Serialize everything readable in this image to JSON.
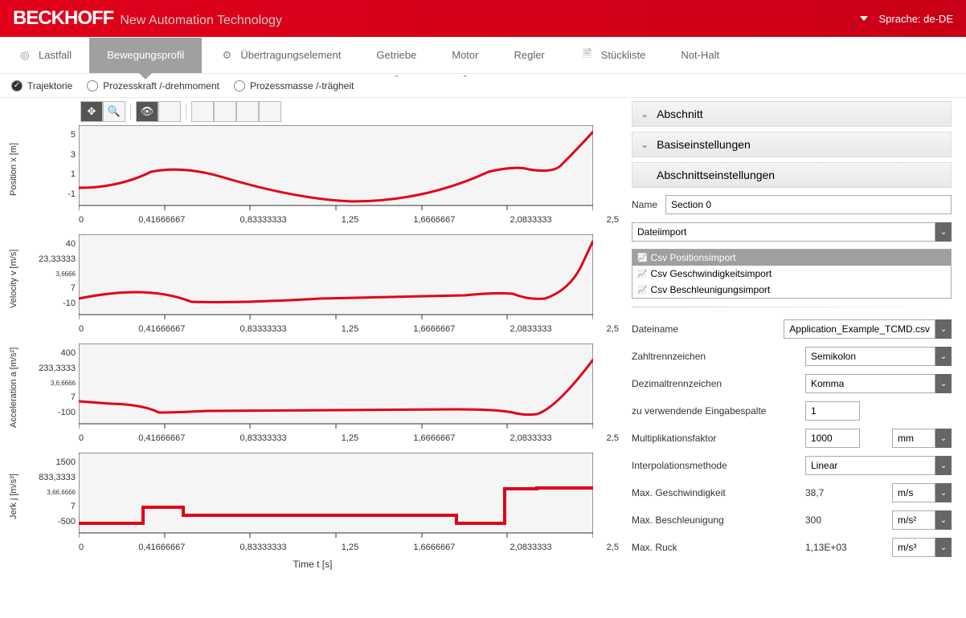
{
  "header": {
    "brand": "BECKHOFF",
    "brandSub": "New Automation Technology",
    "lang": "Sprache: de-DE"
  },
  "tabs": {
    "lastfall": "Lastfall",
    "bewegungsprofil": "Bewegungsprofil",
    "uebertragung": "Übertragungselement",
    "getriebe": "Getriebe",
    "motor": "Motor",
    "regler": "Regler",
    "stueckliste": "Stückliste",
    "nothalt": "Not-Halt"
  },
  "subtabs": {
    "trajektorie": "Trajektorie",
    "prozesskraft": "Prozesskraft /-drehmoment",
    "prozessmasse": "Prozessmasse /-trägheit"
  },
  "charts": {
    "ylabels": {
      "pos": "Position x [m]",
      "vel": "Velocity v [m/s]",
      "acc": "Acceleration a [m/s²]",
      "jerk": "Jerk j [m/s³]"
    },
    "yticks": {
      "pos": [
        "5",
        "3",
        "1",
        "-1"
      ],
      "vel": [
        "40",
        "23,33333",
        "3,6666",
        "7",
        "-10"
      ],
      "acc": [
        "400",
        "233,3333",
        "3,6,6666",
        "7",
        "-100"
      ],
      "jerk": [
        "1500",
        "833,3333",
        "3,66,6666",
        "7",
        "-500"
      ]
    },
    "xticks": [
      "0",
      "0,41666667",
      "0,83333333",
      "1,25",
      "1,6666667",
      "2,0833333",
      "2,5"
    ],
    "xlabel": "Time t [s]"
  },
  "side": {
    "abschnitt": "Abschnitt",
    "basis": "Basiseinstellungen",
    "abschnittSettings": "Abschnittseinstellungen",
    "nameLabel": "Name",
    "nameVal": "Section 0",
    "importType": "Dateiimport",
    "importOptions": {
      "pos": "Csv Positionsimport",
      "vel": "Csv Geschwindigkeitsimport",
      "acc": "Csv Beschleunigungsimport"
    },
    "dateinameLabel": "Dateiname",
    "dateinameVal": "Application_Example_TCMD.csv",
    "zahlLabel": "Zahltrennzeichen",
    "zahlVal": "Semikolon",
    "dezLabel": "Dezimaltrennzeichen",
    "dezVal": "Komma",
    "spalteLabel": "zu verwendende Eingabespalte",
    "spalteVal": "1",
    "multLabel": "Multiplikationsfaktor",
    "multVal": "1000",
    "multUnit": "mm",
    "interpLabel": "Interpolationsmethode",
    "interpVal": "Linear",
    "maxVLabel": "Max. Geschwindigkeit",
    "maxVVal": "38,7",
    "maxVUnit": "m/s",
    "maxALabel": "Max. Beschleunigung",
    "maxAVal": "300",
    "maxAUnit": "m/s²",
    "maxRLabel": "Max. Ruck",
    "maxRVal": "1,13E+03",
    "maxRUnit": "m/s³"
  },
  "chart_data": [
    {
      "type": "line",
      "name": "Position x",
      "x": [
        0,
        0.417,
        0.833,
        1.25,
        1.667,
        2.083,
        2.5
      ],
      "y": [
        0.3,
        0.8,
        -0.1,
        -0.5,
        -0.2,
        0.8,
        4.2
      ],
      "xlabel": "Time t [s]",
      "ylabel": "Position x [m]",
      "ylim": [
        -1,
        5
      ]
    },
    {
      "type": "line",
      "name": "Velocity v",
      "x": [
        0,
        0.417,
        0.833,
        1.25,
        1.667,
        2.083,
        2.5
      ],
      "y": [
        1,
        4,
        0,
        1,
        2,
        3,
        38
      ],
      "xlabel": "Time t [s]",
      "ylabel": "Velocity v [m/s]",
      "ylim": [
        -10,
        40
      ]
    },
    {
      "type": "line",
      "name": "Acceleration a",
      "x": [
        0,
        0.417,
        0.833,
        1.25,
        1.667,
        2.083,
        2.5
      ],
      "y": [
        20,
        -20,
        -20,
        -20,
        -20,
        -40,
        280
      ],
      "xlabel": "Time t [s]",
      "ylabel": "Acceleration a [m/s²]",
      "ylim": [
        -100,
        400
      ]
    },
    {
      "type": "line",
      "name": "Jerk j",
      "x": [
        0,
        0.3,
        0.3,
        0.5,
        0.5,
        1.8,
        1.8,
        2.0,
        2.0,
        2.5
      ],
      "y": [
        -300,
        -300,
        100,
        100,
        -100,
        -100,
        -300,
        -300,
        600,
        600
      ],
      "xlabel": "Time t [s]",
      "ylabel": "Jerk j [m/s³]",
      "ylim": [
        -500,
        1500
      ]
    }
  ]
}
